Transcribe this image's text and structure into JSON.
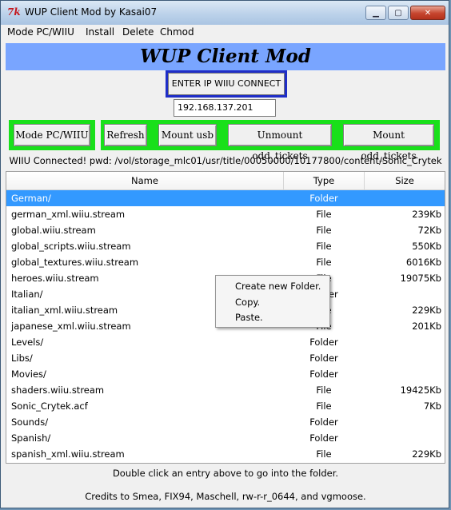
{
  "window": {
    "title": "WUP Client Mod by Kasai07",
    "icon_label": "7k",
    "controls": {
      "minimize": "▁",
      "maximize": "▢",
      "close": "✕"
    }
  },
  "menu": [
    "Mode PC/WIIU",
    "Install",
    "Delete",
    "Chmod"
  ],
  "banner": {
    "title": "WUP Client Mod"
  },
  "connect": {
    "button_label": "ENTER IP WIIU CONNECT",
    "ip_value": "192.168.137.201"
  },
  "toolbar": [
    "Mode PC/WIIU",
    "Refresh",
    "Mount usb",
    "Unmount odd_tickets",
    "Mount odd_tickets"
  ],
  "status": "WIIU Connected! pwd: /vol/storage_mlc01/usr/title/00050000/10177800/content/Sonic_Crytek",
  "table": {
    "headers": [
      "Name",
      "Type",
      "Size"
    ],
    "rows": [
      {
        "name": "German/",
        "type": "Folder",
        "size": ""
      },
      {
        "name": "german_xml.wiiu.stream",
        "type": "File",
        "size": "239Kb"
      },
      {
        "name": "global.wiiu.stream",
        "type": "File",
        "size": "72Kb"
      },
      {
        "name": "global_scripts.wiiu.stream",
        "type": "File",
        "size": "550Kb"
      },
      {
        "name": "global_textures.wiiu.stream",
        "type": "File",
        "size": "6016Kb"
      },
      {
        "name": "heroes.wiiu.stream",
        "type": "File",
        "size": "19075Kb"
      },
      {
        "name": "Italian/",
        "type": "Folder",
        "size": ""
      },
      {
        "name": "italian_xml.wiiu.stream",
        "type": "File",
        "size": "229Kb"
      },
      {
        "name": "japanese_xml.wiiu.stream",
        "type": "File",
        "size": "201Kb"
      },
      {
        "name": "Levels/",
        "type": "Folder",
        "size": ""
      },
      {
        "name": "Libs/",
        "type": "Folder",
        "size": ""
      },
      {
        "name": "Movies/",
        "type": "Folder",
        "size": ""
      },
      {
        "name": "shaders.wiiu.stream",
        "type": "File",
        "size": "19425Kb"
      },
      {
        "name": "Sonic_Crytek.acf",
        "type": "File",
        "size": "7Kb"
      },
      {
        "name": "Sounds/",
        "type": "Folder",
        "size": ""
      },
      {
        "name": "Spanish/",
        "type": "Folder",
        "size": ""
      },
      {
        "name": "spanish_xml.wiiu.stream",
        "type": "File",
        "size": "229Kb"
      }
    ]
  },
  "hint": "Double click an entry above to go into the folder.",
  "credits": "Credits to Smea, FIX94, Maschell, rw-r-r_0644, and vgmoose.",
  "context_menu": [
    "Create new Folder.",
    "Copy.",
    "Paste."
  ],
  "colors": {
    "banner": "#79a5ff",
    "toolbar_bg": "#19e01a",
    "connect_border": "#1f2ec7",
    "selection": "#3399ff"
  }
}
